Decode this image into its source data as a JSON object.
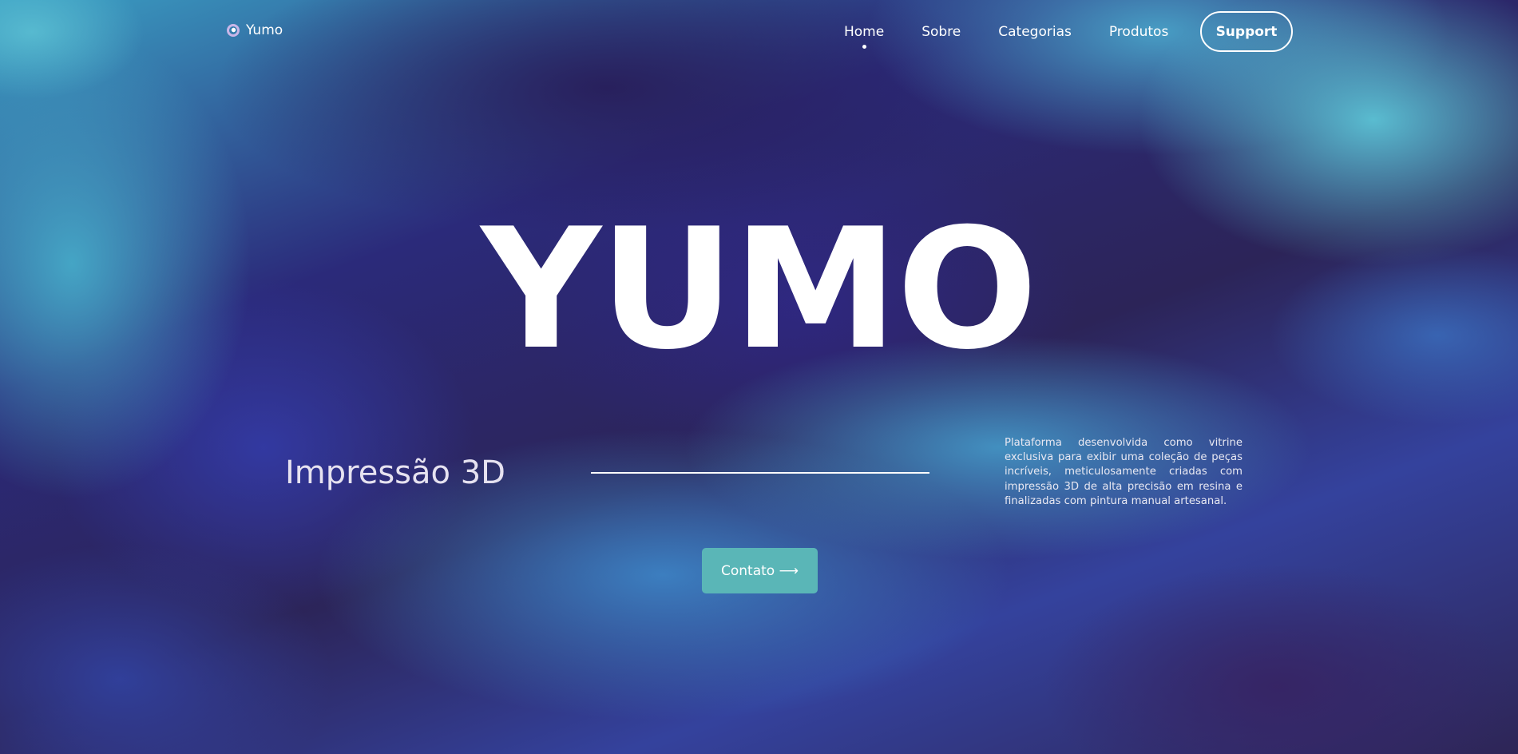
{
  "brand": {
    "name": "Yumo",
    "logo_icon": "ring-logo-icon"
  },
  "nav": {
    "items": [
      {
        "label": "Home",
        "active": true
      },
      {
        "label": "Sobre",
        "active": false
      },
      {
        "label": "Categorias",
        "active": false
      },
      {
        "label": "Produtos",
        "active": false
      }
    ],
    "support_label": "Support"
  },
  "hero": {
    "title": "YUMO",
    "subtitle": "Impressão 3D",
    "description": "Plataforma desenvolvida como vitrine exclusiva para exibir uma coleção de peças incríveis, meticulosamente criadas com impressão 3D de alta precisão em resina e finalizadas com pintura manual artesanal.",
    "cta_label": "Contato ⟶"
  },
  "colors": {
    "cta_background": "#5ab6b7",
    "text": "#ffffff",
    "background_deep": "#2b2150",
    "background_teal": "#5cc4d6"
  }
}
